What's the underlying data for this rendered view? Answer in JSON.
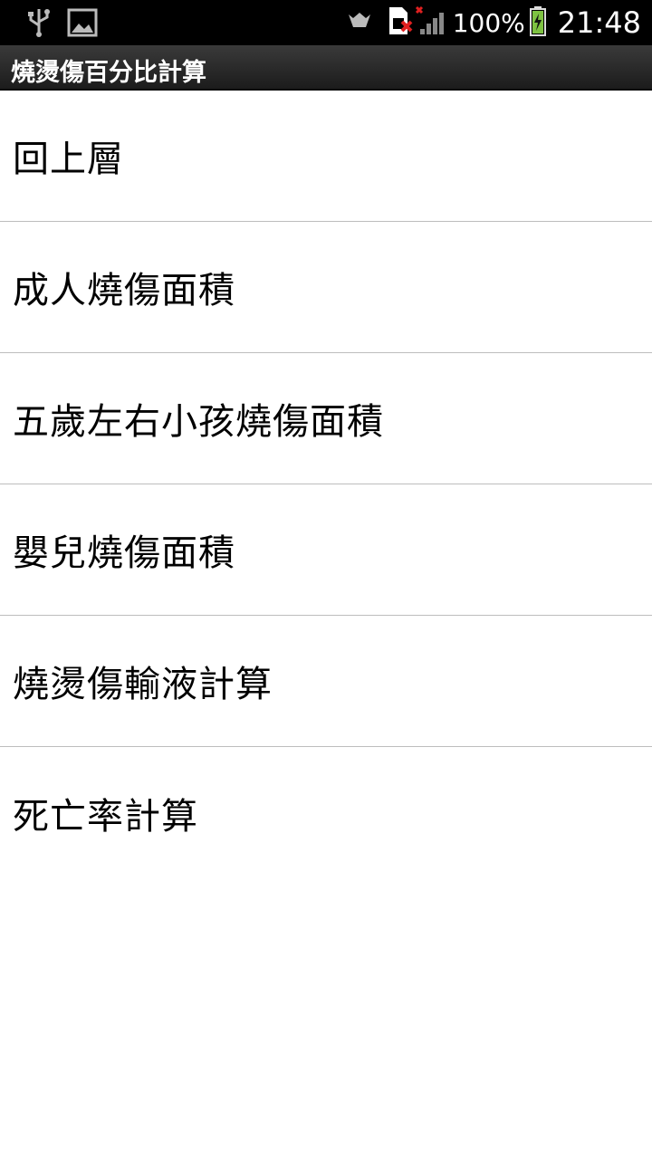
{
  "status_bar": {
    "icons_left": [
      "usb-icon",
      "image-icon"
    ],
    "icons_right": [
      "cloud-sync-icon",
      "no-sim-icon",
      "signal-icon",
      "battery-charging-icon"
    ],
    "battery": "100%",
    "time": "21:48",
    "colors": {
      "background": "#000000",
      "battery_fill": "#7ec242",
      "error_x": "#e02020"
    }
  },
  "app_bar": {
    "title": "燒燙傷百分比計算"
  },
  "menu": {
    "items": [
      {
        "label": "回上層"
      },
      {
        "label": "成人燒傷面積"
      },
      {
        "label": "五歲左右小孩燒傷面積"
      },
      {
        "label": "嬰兒燒傷面積"
      },
      {
        "label": "燒燙傷輸液計算"
      },
      {
        "label": "死亡率計算"
      }
    ]
  }
}
